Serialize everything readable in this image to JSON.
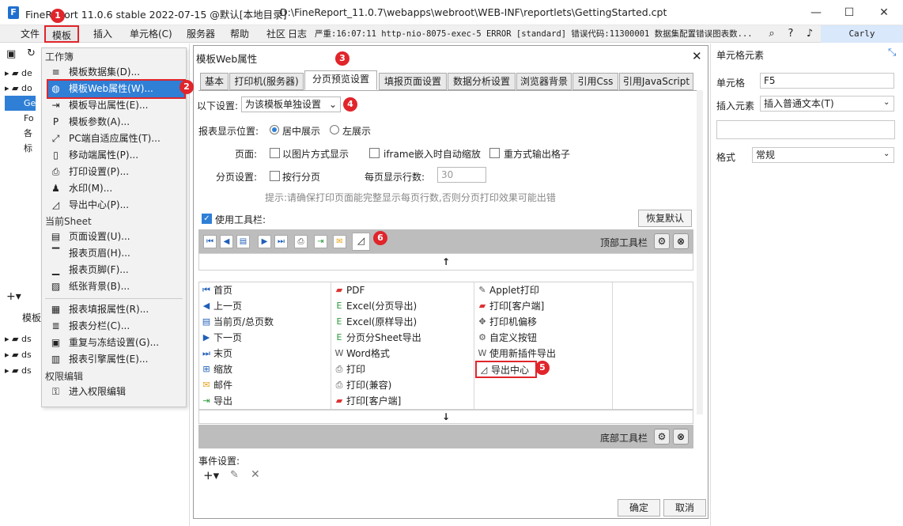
{
  "app": {
    "logo": "F",
    "title": "FineReport 11.0.6 stable 2022-07-15 @默认[本地目录]",
    "path": "D:\\FineReport_11.0.7\\webapps\\webroot\\WEB-INF\\reportlets\\GettingStarted.cpt",
    "min": "—",
    "max": "☐",
    "close": "✕"
  },
  "menubar": {
    "file": "文件",
    "template": "模板",
    "insert": "插入",
    "cell": "单元格(C)",
    "server": "服务器",
    "help": "帮助",
    "community": "社区",
    "log": "日志",
    "logtext": "严重:16:07:11 http-nio-8075-exec-5 ERROR [standard] 错误代码:11300001 数据集配置错误图表数...",
    "user": "Carly"
  },
  "left_panel": {
    "tree": [
      "de",
      "do",
      "Ge",
      "Fo",
      "各",
      "标"
    ],
    "lower_title": "模板",
    "ds": [
      "ds",
      "ds",
      "ds"
    ]
  },
  "dropdown": {
    "sec1": "工作簿",
    "items1": [
      "模板数据集(D)...",
      "模板Web属性(W)...",
      "模板导出属性(E)...",
      "模板参数(A)...",
      "PC端自适应属性(T)...",
      "移动端属性(P)...",
      "打印设置(P)...",
      "水印(M)...",
      "导出中心(P)..."
    ],
    "sec2": "当前Sheet",
    "items2": [
      "页面设置(U)...",
      "报表页眉(H)...",
      "报表页脚(F)...",
      "纸张背景(B)..."
    ],
    "items3": [
      "报表填报属性(R)...",
      "报表分栏(C)...",
      "重复与冻结设置(G)...",
      "报表引擎属性(E)..."
    ],
    "sec3": "权限编辑",
    "items4": [
      "进入权限编辑"
    ]
  },
  "badges": [
    "1",
    "2",
    "3",
    "4",
    "5",
    "6"
  ],
  "dialog": {
    "title": "模板Web属性",
    "close": "✕",
    "tabs": [
      "基本",
      "打印机(服务器)",
      "分页预览设置",
      "填报页面设置",
      "数据分析设置",
      "浏览器背景",
      "引用Css",
      "引用JavaScript"
    ],
    "setting_label": "以下设置:",
    "setting_value": "为该模板单独设置",
    "display_pos_label": "报表显示位置:",
    "center": "居中展示",
    "left": "左展示",
    "page_label": "页面:",
    "as_image": "以图片方式显示",
    "iframe_zoom": "iframe嵌入时自动缩放",
    "repeat_output": "重方式输出格子",
    "paging_label": "分页设置:",
    "by_row": "按行分页",
    "rows_label": "每页显示行数:",
    "rows_value": "30",
    "hint": "提示:请确保打印页面能完整显示每页行数,否则分页打印效果可能出错",
    "use_toolbar": "使用工具栏:",
    "restore": "恢复默认",
    "top_toolbar": "顶部工具栏",
    "bottom_toolbar": "底部工具栏",
    "up": "↑",
    "down": "↓",
    "col1": [
      "首页",
      "上一页",
      "当前页/总页数",
      "下一页",
      "末页",
      "缩放",
      "邮件",
      "导出"
    ],
    "col2": [
      "PDF",
      "Excel(分页导出)",
      "Excel(原样导出)",
      "分页分Sheet导出",
      "Word格式",
      "打印",
      "打印(兼容)",
      "打印[客户端]"
    ],
    "col3": [
      "Applet打印",
      "打印[客户端]",
      "打印机偏移",
      "自定义按钮",
      "使用新插件导出",
      "导出中心"
    ],
    "event_label": "事件设置:",
    "ok": "确定",
    "cancel": "取消"
  },
  "right_panel": {
    "title": "单元格元素",
    "cell_label": "单元格",
    "cell_value": "F5",
    "insert_label": "插入元素",
    "insert_value": "插入普通文本(T)",
    "format_label": "格式",
    "format_value": "常规"
  }
}
